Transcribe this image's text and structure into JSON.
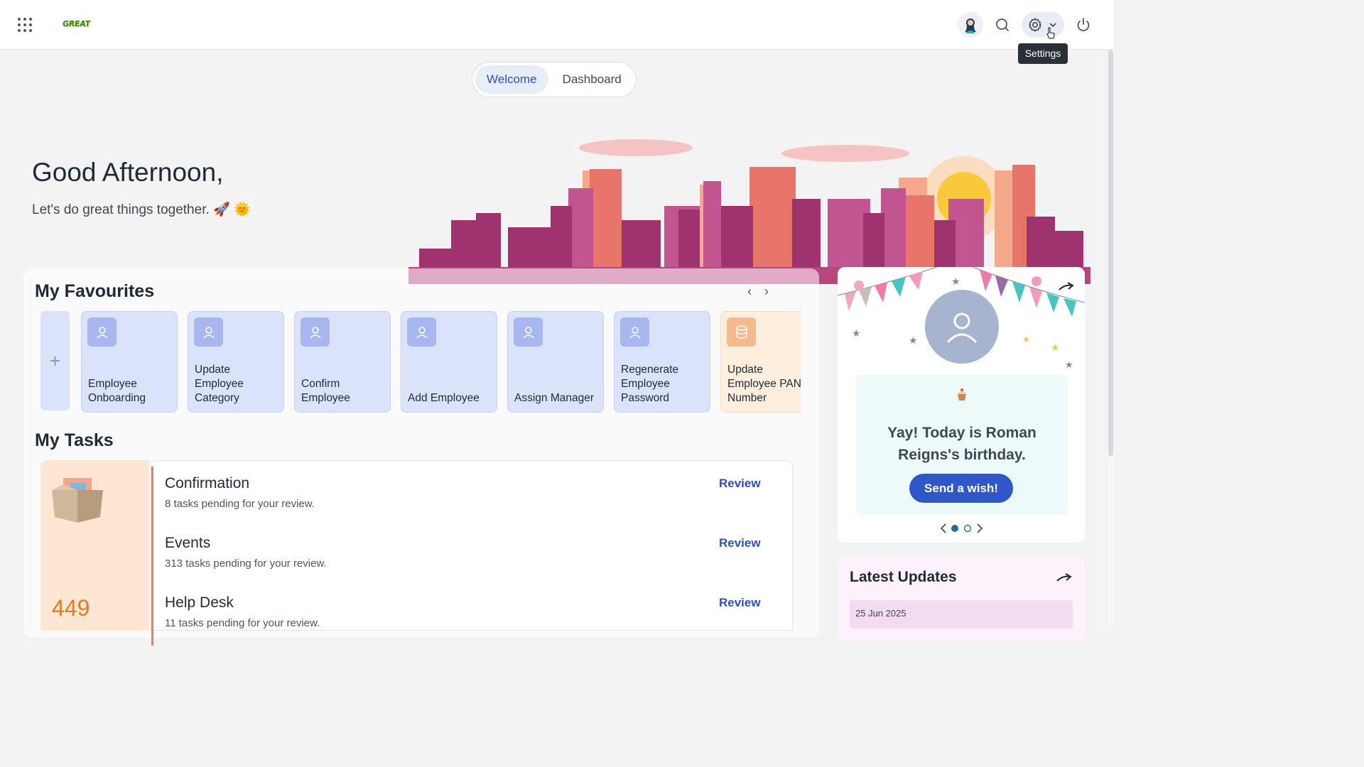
{
  "header": {
    "logo_text": "GREAT",
    "settings_tooltip": "Settings",
    "icons": [
      "apps-grid-icon",
      "user-avatar",
      "search-icon",
      "gear-icon",
      "chevron-down-icon",
      "power-icon"
    ]
  },
  "tabs": [
    {
      "label": "Welcome",
      "active": true
    },
    {
      "label": "Dashboard",
      "active": false
    }
  ],
  "greeting": {
    "title": "Good Afternoon,",
    "subtitle": "Let's do great things together. 🚀 🌞"
  },
  "favourites": {
    "title": "My Favourites",
    "items": [
      {
        "label": "Employee Onboarding",
        "icon": "user-icon"
      },
      {
        "label": "Update Employee Category",
        "icon": "user-icon"
      },
      {
        "label": "Confirm Employee",
        "icon": "user-icon"
      },
      {
        "label": "Add Employee",
        "icon": "user-icon"
      },
      {
        "label": "Assign Manager",
        "icon": "user-icon"
      },
      {
        "label": "Regenerate Employee Password",
        "icon": "user-icon"
      },
      {
        "label": "Update Employee PAN Number",
        "icon": "database-icon"
      }
    ]
  },
  "tasks": {
    "title": "My Tasks",
    "total": "449",
    "items": [
      {
        "title": "Confirmation",
        "sub": "8 tasks pending for your review.",
        "action": "Review"
      },
      {
        "title": "Events",
        "sub": "313 tasks pending for your review.",
        "action": "Review"
      },
      {
        "title": "Help Desk",
        "sub": "11 tasks pending for your review.",
        "action": "Review"
      }
    ]
  },
  "birthday": {
    "message": "Yay! Today is Roman Reigns's birthday.",
    "button": "Send a wish!",
    "pager": {
      "current": 1,
      "total": 2
    }
  },
  "updates": {
    "title": "Latest Updates",
    "first_date": "25 Jun 2025"
  },
  "colors": {
    "accent": "#2f57c8",
    "task_border": "#e87f5c",
    "task_count": "#e07b27"
  }
}
